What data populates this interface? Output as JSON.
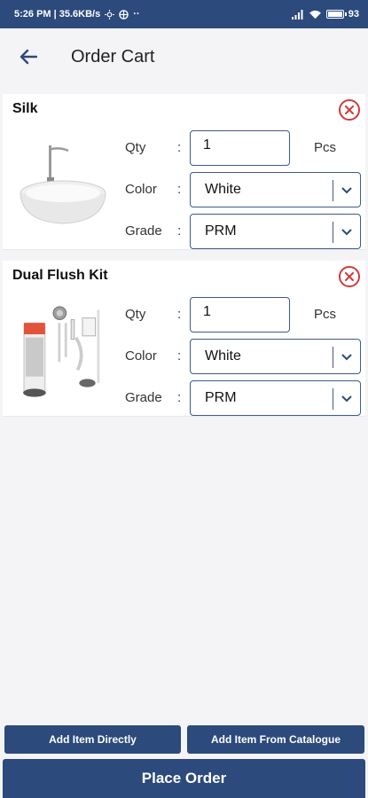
{
  "status_bar": {
    "time_speed": "5:26 PM | 35.6KB/s",
    "battery": "93"
  },
  "header": {
    "title": "Order Cart"
  },
  "labels": {
    "qty": "Qty",
    "color": "Color",
    "grade": "Grade",
    "colon": ":"
  },
  "items": [
    {
      "name": "Silk",
      "qty": "1",
      "unit": "Pcs",
      "color": "White",
      "grade": "PRM"
    },
    {
      "name": "Dual Flush Kit",
      "qty": "1",
      "unit": "Pcs",
      "color": "White",
      "grade": "PRM"
    }
  ],
  "actions": {
    "add_direct": "Add Item Directly",
    "add_catalogue": "Add Item From Catalogue",
    "place_order": "Place Order"
  },
  "colors": {
    "primary": "#2c4a7c",
    "remove": "#d13b3b"
  }
}
